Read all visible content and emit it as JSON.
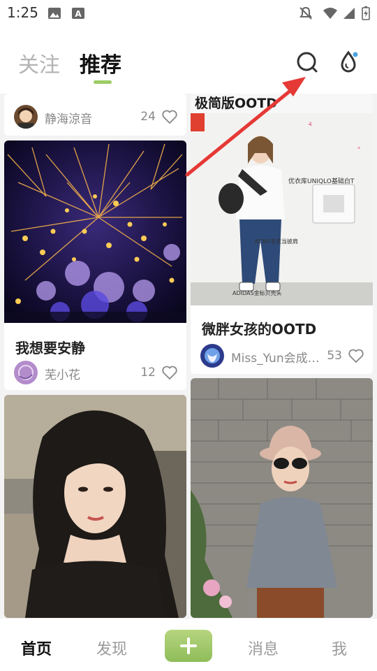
{
  "status_bar": {
    "time": "1:25",
    "icons": [
      "image-icon",
      "text-a-icon",
      "mute-icon",
      "wifi-icon",
      "signal-icon",
      "battery-charging-icon"
    ]
  },
  "header": {
    "tabs": [
      {
        "label": "关注",
        "active": false
      },
      {
        "label": "推荐",
        "active": true
      }
    ],
    "accent_color": "#9ccc65",
    "right_icons": [
      "search-icon",
      "drop-icon"
    ]
  },
  "feed": {
    "left_column": [
      {
        "author": "静海涼音",
        "likes": "24",
        "image": "partial-top"
      },
      {
        "title": "我想要安静",
        "author": "芜小花",
        "likes": "12",
        "image": "fireworks-photo"
      },
      {
        "image": "woman-selfie-photo"
      }
    ],
    "right_column": [
      {
        "title": "微胖女孩的OOTD",
        "author": "Miss_Yun会成…",
        "likes": "53",
        "image": "ootd-photo",
        "image_text": [
          "极简版OOTD",
          "优衣库UNIQLO基础白T",
          "ADIDAS金标贝壳头",
          "ACNE毛衣当披肩"
        ]
      },
      {
        "image": "woman-hat-photo"
      }
    ]
  },
  "bottom_nav": {
    "items": [
      {
        "label": "首页",
        "active": true
      },
      {
        "label": "发现",
        "active": false
      },
      {
        "label": "消息",
        "active": false
      },
      {
        "label": "我",
        "active": false
      }
    ],
    "add_icon": "plus-icon"
  },
  "annotation": {
    "type": "arrow",
    "color": "#e53935",
    "target": "search-icon"
  }
}
